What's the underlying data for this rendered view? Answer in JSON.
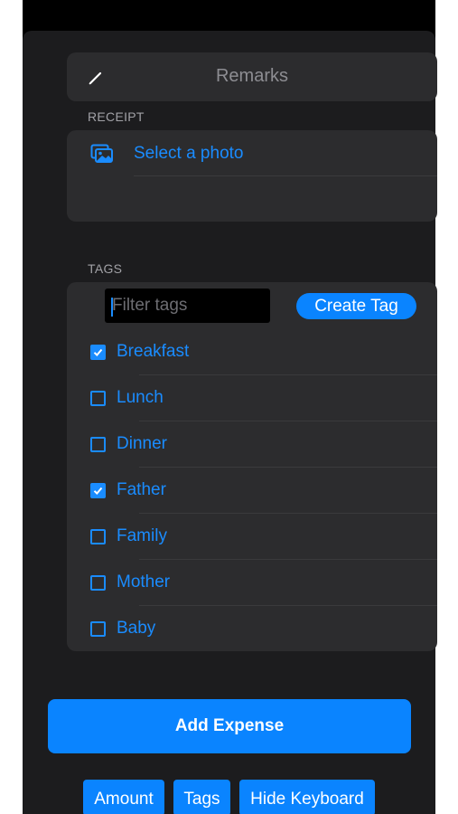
{
  "remarks": {
    "placeholder": "Remarks",
    "icon": "pencil-icon"
  },
  "receipt": {
    "section_label": "RECEIPT",
    "select_photo_label": "Select a photo",
    "icon": "photo-icon"
  },
  "tags": {
    "section_label": "TAGS",
    "filter_placeholder": "Filter tags",
    "filter_value": "",
    "create_tag_label": "Create Tag",
    "items": [
      {
        "label": "Breakfast",
        "checked": true
      },
      {
        "label": "Lunch",
        "checked": false
      },
      {
        "label": "Dinner",
        "checked": false
      },
      {
        "label": "Father",
        "checked": true
      },
      {
        "label": "Family",
        "checked": false
      },
      {
        "label": "Mother",
        "checked": false
      },
      {
        "label": "Baby",
        "checked": false
      }
    ]
  },
  "actions": {
    "add_expense_label": "Add Expense"
  },
  "keyboard_toolbar": {
    "amount_label": "Amount",
    "tags_label": "Tags",
    "hide_keyboard_label": "Hide Keyboard"
  },
  "colors": {
    "accent": "#0a84ff",
    "background": "#1c1c1e",
    "card": "#2c2c2e"
  }
}
